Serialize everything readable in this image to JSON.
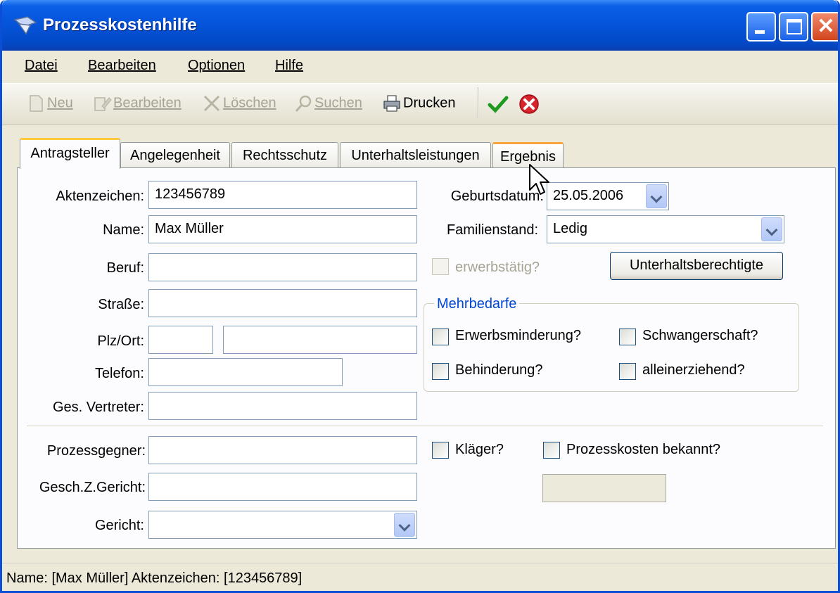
{
  "window": {
    "title": "Prozesskostenhilfe"
  },
  "menu": [
    {
      "label": "Datei"
    },
    {
      "label": "Bearbeiten"
    },
    {
      "label": "Optionen"
    },
    {
      "label": "Hilfe"
    }
  ],
  "toolbar": {
    "new_label": "Neu",
    "edit_label": "Bearbeiten",
    "delete_label": "Löschen",
    "search_label": "Suchen",
    "print_label": "Drucken"
  },
  "tabs": [
    {
      "label": "Antragsteller"
    },
    {
      "label": "Angelegenheit"
    },
    {
      "label": "Rechtsschutz"
    },
    {
      "label": "Unterhaltsleistungen"
    },
    {
      "label": "Ergebnis"
    }
  ],
  "form": {
    "aktenzeichen": {
      "label": "Aktenzeichen:",
      "value": "123456789"
    },
    "name": {
      "label": "Name:",
      "value": "Max Müller"
    },
    "beruf": {
      "label": "Beruf:",
      "value": ""
    },
    "strasse": {
      "label": "Straße:",
      "value": ""
    },
    "plz_ort": {
      "label": "Plz/Ort:",
      "plz": "",
      "ort": ""
    },
    "telefon": {
      "label": "Telefon:",
      "value": ""
    },
    "vertreter": {
      "label": "Ges. Vertreter:",
      "value": ""
    },
    "geburtsdatum": {
      "label": "Geburtsdatum:",
      "value": "25.05.2006"
    },
    "familienstand": {
      "label": "Familienstand:",
      "value": "Ledig"
    },
    "erwerbstaetig": {
      "label": "erwerbstätig?"
    },
    "unterhalt_button": "Unterhaltsberechtigte",
    "mehrbedarfe": {
      "legend": "Mehrbedarfe",
      "erwerbsminderung": "Erwerbsminderung?",
      "schwangerschaft": "Schwangerschaft?",
      "behinderung": "Behinderung?",
      "alleinerziehend": "alleinerziehend?"
    },
    "prozessgegner": {
      "label": "Prozessgegner:",
      "value": ""
    },
    "geschz": {
      "label": "Gesch.Z.Gericht:",
      "value": ""
    },
    "gericht": {
      "label": "Gericht:",
      "value": ""
    },
    "klaeger": "Kläger?",
    "prozesskosten": "Prozesskosten bekannt?"
  },
  "status": {
    "text": "Name: [Max Müller] Aktenzeichen: [123456789]"
  }
}
